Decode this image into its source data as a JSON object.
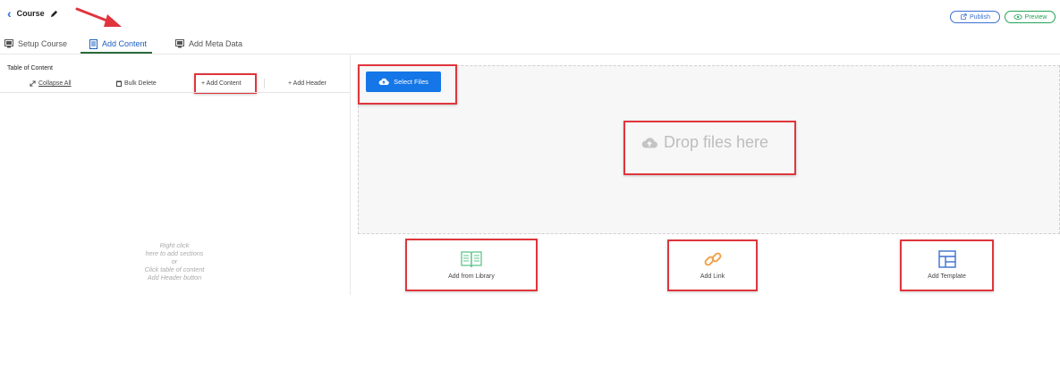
{
  "header": {
    "back_icon": "chevron-left-icon",
    "title": "Course",
    "edit_icon": "pencil-icon",
    "publish_label": "Publish",
    "preview_label": "Preview"
  },
  "tabs": [
    {
      "label": "Setup Course",
      "icon": "monitor-icon",
      "active": false
    },
    {
      "label": "Add Content",
      "icon": "document-icon",
      "active": true
    },
    {
      "label": "Add Meta Data",
      "icon": "monitor-icon",
      "active": false
    }
  ],
  "toc": {
    "title": "Table of Content",
    "collapse_all": "Collapse All",
    "bulk_delete": "Bulk Delete",
    "add_content": "+ Add Content",
    "add_header": "+ Add Header",
    "hint_lines": [
      "Right click",
      "here to add sections",
      "or",
      "Click table of content",
      "Add Header button"
    ]
  },
  "upload": {
    "select_files_label": "Select Files",
    "drop_text": "Drop files here"
  },
  "cards": [
    {
      "label": "Add from Library",
      "icon": "book-icon"
    },
    {
      "label": "Add Link",
      "icon": "link-icon"
    },
    {
      "label": "Add Template",
      "icon": "template-icon"
    }
  ],
  "colors": {
    "primary": "#1576e8",
    "highlight": "#e0353d",
    "active_tab_underline": "#2a6a3c",
    "library_icon": "#5cc48a",
    "link_icon": "#f0a24a",
    "template_icon": "#3b6fd1"
  }
}
